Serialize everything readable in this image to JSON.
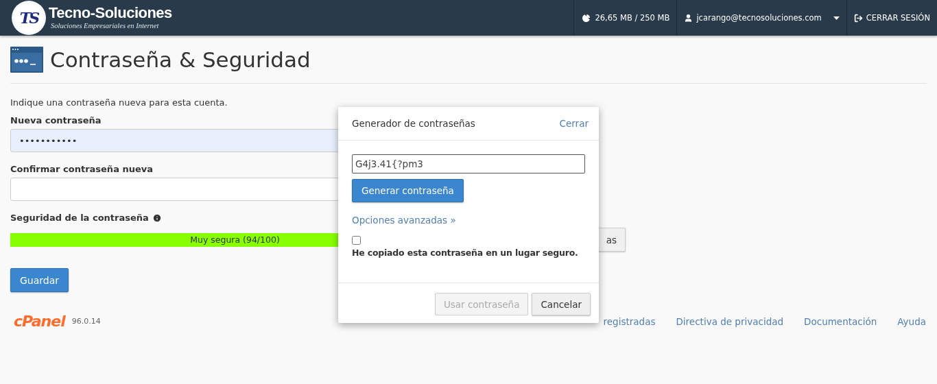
{
  "header": {
    "logo_mark": "TS",
    "brand": "Tecno-Soluciones",
    "tagline": "Soluciones Empresariales en Internet",
    "quota": "26,65 MB / 250 MB",
    "user": "jcarango@tecnosoluciones.com",
    "logout": "CERRAR SESIÓN"
  },
  "page": {
    "title": "Contraseña & Seguridad",
    "intro": "Indique una contraseña nueva para esta cuenta.",
    "fields": [
      {
        "label": "Nueva contraseña",
        "value": "•••••••••••",
        "autofilled": true
      },
      {
        "label": "Confirmar contraseña nueva",
        "autofilled": false
      }
    ],
    "strength": {
      "label": "Seguridad de la contraseña",
      "level": 0.94,
      "reading": "Muy segura (94/100)"
    },
    "generator_button": "as",
    "save_button": "Guardar"
  },
  "footer": {
    "brand": "cPanel",
    "version": "96.0.14",
    "links": [
      "registradas",
      "Directiva de privacidad",
      "Documentación",
      "Ayuda"
    ]
  },
  "modal": {
    "title": "Generador de contraseñas",
    "close": "Cerrar",
    "password": "G4j3.41{?pm3",
    "generate_button": "Generar contraseña",
    "advanced_link": "Opciones avanzadas »",
    "confirm": {
      "label": "He copiado esta contraseña en un lugar seguro.",
      "checked": false
    },
    "buttons": [
      {
        "label": "Usar contraseña",
        "disabled": true
      },
      {
        "label": "Cancelar",
        "disabled": false
      }
    ]
  }
}
